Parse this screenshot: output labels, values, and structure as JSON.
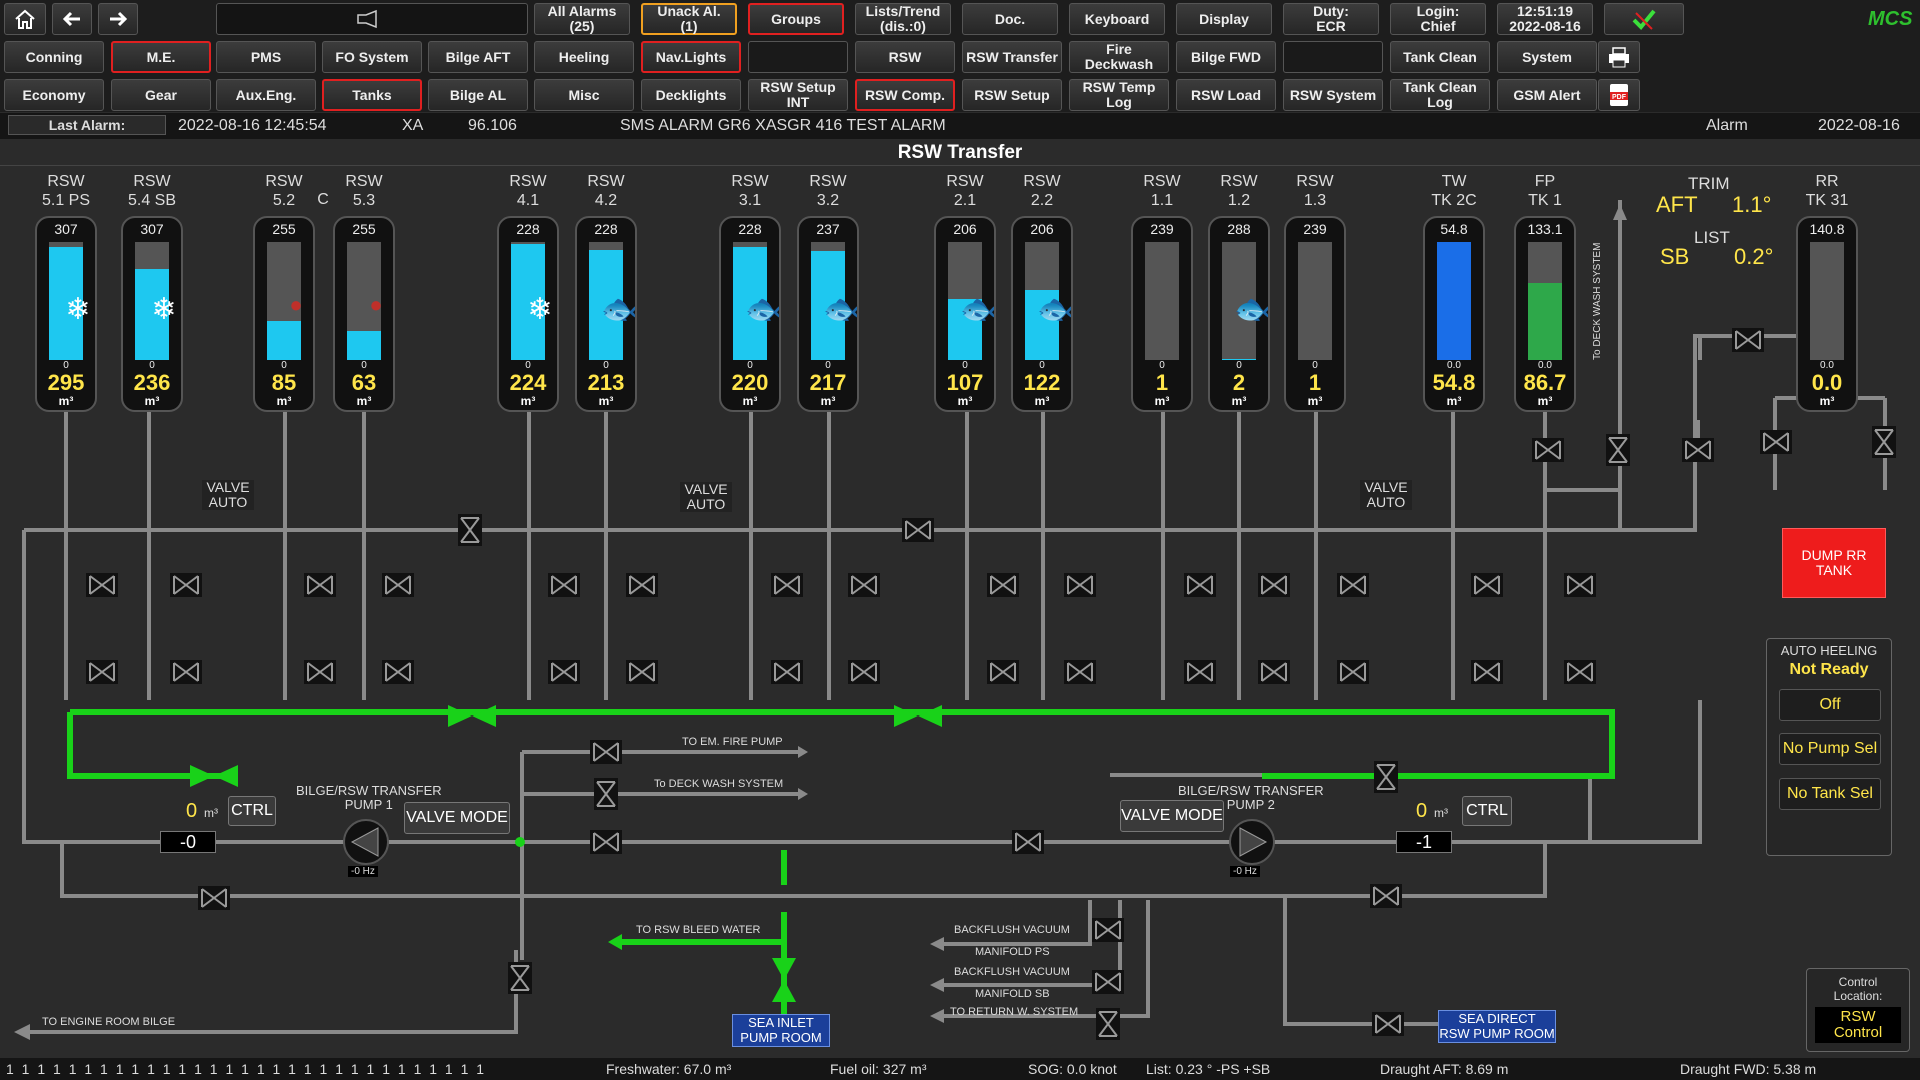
{
  "nav": {
    "home": "home-icon",
    "back": "back-arrow-icon",
    "forward": "forward-arrow-icon",
    "row1": [
      "All Alarms\n(25)",
      "Unack Al.\n(1)",
      "Groups",
      "Lists/Trend\n(dis.:0)",
      "Doc.",
      "Keyboard",
      "Display",
      "Duty:\nECR",
      "Login:\nChief",
      "12:51:19\n2022-08-16"
    ],
    "row2": [
      "Conning",
      "M.E.",
      "PMS",
      "FO System",
      "Bilge AFT",
      "Heeling",
      "Nav.Lights",
      "",
      "RSW",
      "RSW Transfer",
      "Fire Deckwash",
      "Bilge FWD",
      "",
      "Tank Clean",
      "System"
    ],
    "row3": [
      "Economy",
      "Gear",
      "Aux.Eng.",
      "Tanks",
      "Bilge AL",
      "Misc",
      "Decklights",
      "RSW Setup INT",
      "RSW Comp.",
      "RSW Setup",
      "RSW Temp Log",
      "RSW Load",
      "RSW System",
      "Tank Clean Log",
      "GSM Alert"
    ],
    "logo": "MCS"
  },
  "alarm": {
    "label": "Last Alarm:",
    "time": "2022-08-16 12:45:54",
    "code": "XA",
    "value": "96.106",
    "text": "SMS ALARM GR6 XASGR 416 TEST ALARM",
    "type": "Alarm",
    "date": "2022-08-16"
  },
  "title": "RSW Transfer",
  "tanks": [
    {
      "l1": "RSW",
      "l2": "5.1 PS",
      "cap": "307",
      "vol": "295",
      "sym": "❄",
      "fill": 0.96,
      "kind": "cyan"
    },
    {
      "l1": "RSW",
      "l2": "5.4 SB",
      "cap": "307",
      "vol": "236",
      "sym": "❄",
      "fill": 0.77,
      "kind": "cyan"
    },
    {
      "l1": "RSW",
      "l2": "5.2",
      "cap": "255",
      "vol": "85",
      "sym": "●",
      "fill": 0.33,
      "kind": "cyan"
    },
    {
      "l1": "RSW",
      "l2": "5.3",
      "cap": "255",
      "vol": "63",
      "sym": "●",
      "fill": 0.25,
      "kind": "cyan"
    },
    {
      "l1": "RSW",
      "l2": "4.1",
      "cap": "228",
      "vol": "224",
      "sym": "❄",
      "fill": 0.98,
      "kind": "cyan"
    },
    {
      "l1": "RSW",
      "l2": "4.2",
      "cap": "228",
      "vol": "213",
      "sym": "🐟",
      "fill": 0.93,
      "kind": "cyan"
    },
    {
      "l1": "RSW",
      "l2": "3.1",
      "cap": "228",
      "vol": "220",
      "sym": "🐟",
      "fill": 0.96,
      "kind": "cyan"
    },
    {
      "l1": "RSW",
      "l2": "3.2",
      "cap": "237",
      "vol": "217",
      "sym": "🐟",
      "fill": 0.92,
      "kind": "cyan"
    },
    {
      "l1": "RSW",
      "l2": "2.1",
      "cap": "206",
      "vol": "107",
      "sym": "🐟",
      "fill": 0.52,
      "kind": "cyan"
    },
    {
      "l1": "RSW",
      "l2": "2.2",
      "cap": "206",
      "vol": "122",
      "sym": "🐟",
      "fill": 0.59,
      "kind": "cyan"
    },
    {
      "l1": "RSW",
      "l2": "1.1",
      "cap": "239",
      "vol": "1",
      "sym": "",
      "fill": 0.0,
      "kind": "cyan"
    },
    {
      "l1": "RSW",
      "l2": "1.2",
      "cap": "288",
      "vol": "2",
      "sym": "🐟",
      "fill": 0.01,
      "kind": "cyan"
    },
    {
      "l1": "RSW",
      "l2": "1.3",
      "cap": "239",
      "vol": "1",
      "sym": "",
      "fill": 0.0,
      "kind": "cyan"
    },
    {
      "l1": "TW",
      "l2": "TK 2C",
      "cap": "54.8",
      "vol": "54.8",
      "sym": "",
      "fill": 1.0,
      "kind": "blue",
      "zero": "0.0"
    },
    {
      "l1": "FP",
      "l2": "TK 1",
      "cap": "133.1",
      "vol": "86.7",
      "sym": "",
      "fill": 0.65,
      "kind": "green",
      "zero": "0.0"
    },
    {
      "l1": "RR",
      "l2": "TK 31",
      "cap": "140.8",
      "vol": "0.0",
      "sym": "",
      "fill": 0.0,
      "kind": "cyan",
      "zero": "0.0"
    }
  ],
  "unit": "m³",
  "c_label": "C",
  "trim": {
    "title": "TRIM",
    "aft": "AFT",
    "trim_val": "1.1°",
    "list_title": "LIST",
    "sb": "SB",
    "list_val": "0.2°"
  },
  "valve_auto": "VALVE\nAUTO",
  "labels": {
    "deck_wash_vertical": "To DECK WASH SYSTEM",
    "to_em_fire": "TO EM. FIRE PUMP",
    "to_deck_wash": "To DECK WASH SYSTEM",
    "pump1": "BILGE/RSW TRANSFER\nPUMP 1",
    "pump2": "BILGE/RSW TRANSFER\nPUMP 2",
    "valve_mode": "VALVE MODE",
    "ctrl": "CTRL",
    "p1_vol": "0",
    "p2_vol": "0",
    "p1_num": "-0",
    "p2_num": "-1",
    "p1_hz": "-0 Hz",
    "p2_hz": "-0 Hz",
    "bleed": "TO RSW BLEED WATER",
    "backflush_ps": "BACKFLUSH VACUUM",
    "manifold_ps": "MANIFOLD PS",
    "backflush_sb": "BACKFLUSH VACUUM",
    "manifold_sb": "MANIFOLD SB",
    "return_w": "TO RETURN W. SYSTEM",
    "engine_bilge": "TO ENGINE ROOM BILGE",
    "sea_inlet": "SEA INLET\nPUMP ROOM",
    "sea_direct": "SEA DIRECT\nRSW PUMP ROOM"
  },
  "dump": "DUMP RR\nTANK",
  "heeling": {
    "title": "AUTO HEELING",
    "status": "Not Ready",
    "b1": "Off",
    "b2": "No Pump Sel",
    "b3": "No Tank Sel"
  },
  "control": {
    "title": "Control\nLocation:",
    "value": "RSW\nControl"
  },
  "bottom": {
    "ticks": "1 1 1 1 1 1 1 1 1 1 1 1 1 1 1 1 1 1 1 1 1 1 1 1 1 1 1 1 1 1 1",
    "freshwater": "Freshwater: 67.0 m³",
    "fueloil": "Fuel oil: 327 m³",
    "sog": "SOG: 0.0 knot",
    "list": "List: 0.23 ° -PS +SB",
    "draught_aft": "Draught AFT: 8.69 m",
    "draught_fwd": "Draught FWD: 5.38 m"
  },
  "colors": {
    "green_pipe": "#19d219",
    "grey_pipe": "#8a8a8a",
    "fill_cyan": "#1ec8f0",
    "alarm_red": "#e02020",
    "yellow_value": "#ffe54a"
  }
}
